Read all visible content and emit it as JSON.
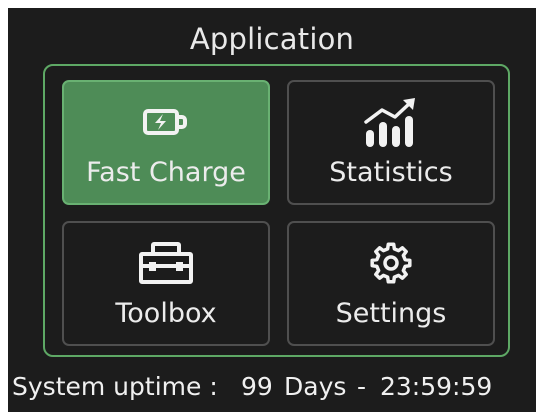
{
  "app": {
    "title": "Application"
  },
  "tiles": [
    {
      "label": "Fast Charge",
      "icon": "battery-charge-icon",
      "selected": true
    },
    {
      "label": "Statistics",
      "icon": "bar-chart-trend-icon",
      "selected": false
    },
    {
      "label": "Toolbox",
      "icon": "toolbox-icon",
      "selected": false
    },
    {
      "label": "Settings",
      "icon": "gear-icon",
      "selected": false
    }
  ],
  "status": {
    "label": "System uptime :",
    "days": "99",
    "days_unit": "Days",
    "separator": "-",
    "time": "23:59:59"
  },
  "colors": {
    "background": "#1c1c1c",
    "accent": "#5ea865",
    "selected_tile": "#4e8c57",
    "tile_border": "#4f4f4f",
    "text": "#e9e9e9"
  }
}
